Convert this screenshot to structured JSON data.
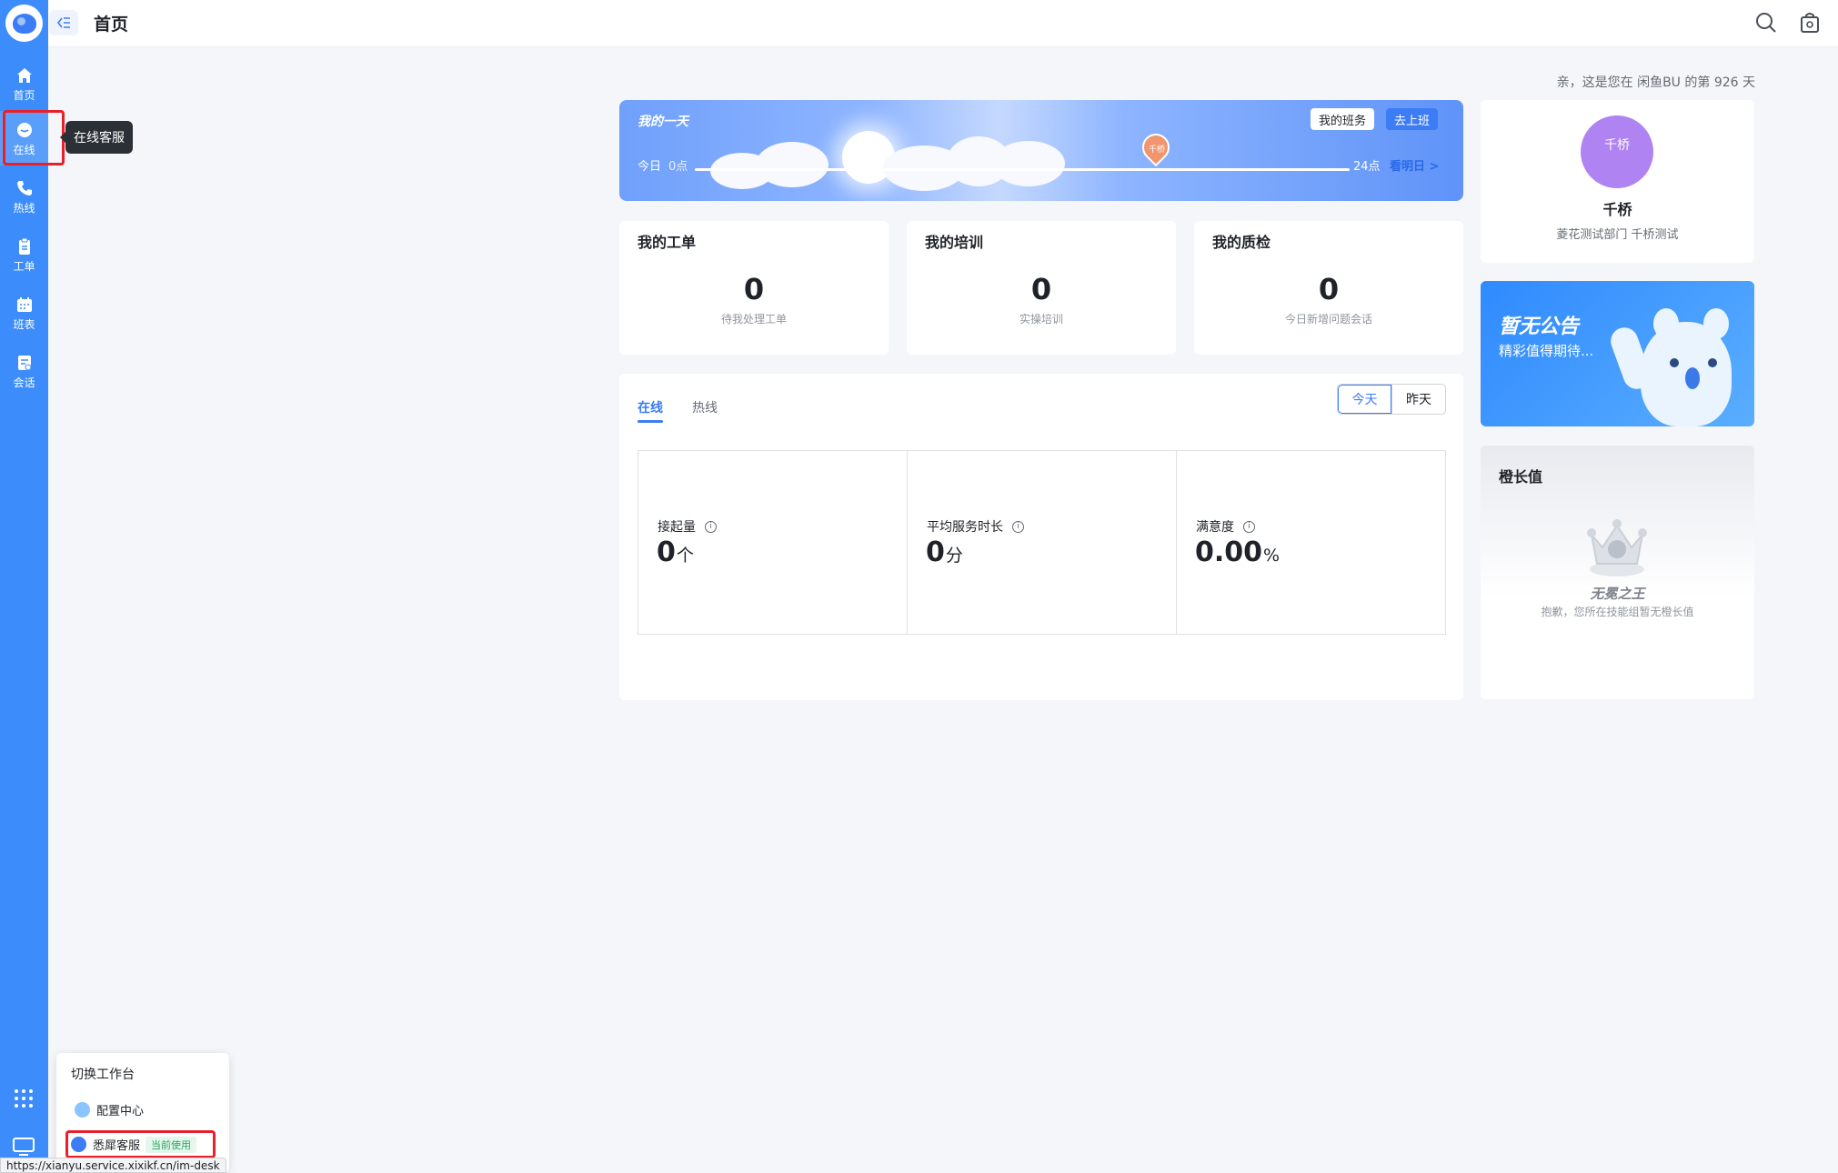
{
  "header": {
    "title": "首页"
  },
  "sidebar": {
    "items": [
      {
        "label": "首页",
        "icon": "home-icon"
      },
      {
        "label": "在线",
        "icon": "chat-icon"
      },
      {
        "label": "热线",
        "icon": "phone-icon"
      },
      {
        "label": "工单",
        "icon": "clipboard-icon"
      },
      {
        "label": "班表",
        "icon": "calendar-icon"
      },
      {
        "label": "会话",
        "icon": "conversation-icon"
      }
    ],
    "active_tooltip": "在线客服"
  },
  "greeting": "亲，这是您在 闲鱼BU 的第 926 天",
  "day": {
    "title": "我的一天",
    "schedule_btn": "我的班务",
    "gowork_btn": "去上班",
    "start_label": "今日",
    "start_time": "0点",
    "end_time": "24点",
    "tomorrow_link": "看明日 >",
    "pin_label": "千桥"
  },
  "stats": [
    {
      "title": "我的工单",
      "value": "0",
      "sub": "待我处理工单"
    },
    {
      "title": "我的培训",
      "value": "0",
      "sub": "实操培训"
    },
    {
      "title": "我的质检",
      "value": "0",
      "sub": "今日新增问题会话"
    }
  ],
  "data_panel": {
    "tabs": [
      "在线",
      "热线"
    ],
    "range": [
      "今天",
      "昨天"
    ],
    "metrics": [
      {
        "label": "接起量",
        "value": "0",
        "unit": "个"
      },
      {
        "label": "平均服务时长",
        "value": "0",
        "unit": "分"
      },
      {
        "label": "满意度",
        "value": "0.00",
        "unit": "%"
      }
    ]
  },
  "profile": {
    "avatar_text": "千桥",
    "name": "千桥",
    "dept": "菱花测试部门 千桥测试"
  },
  "notice": {
    "title": "暂无公告",
    "subtitle": "精彩值得期待..."
  },
  "growth": {
    "title": "橙长值",
    "rank": "无冕之王",
    "subtitle": "抱歉，您所在技能组暂无橙长值"
  },
  "workspace_popup": {
    "title": "切换工作台",
    "items": [
      {
        "label": "配置中心"
      },
      {
        "label": "悉犀客服",
        "badge": "当前使用"
      }
    ]
  },
  "status_url": "https://xianyu.service.xixikf.cn/im-desk",
  "colors": {
    "primary": "#3c8dfb",
    "accent": "#3c7cf5",
    "highlight": "#e8202a"
  }
}
